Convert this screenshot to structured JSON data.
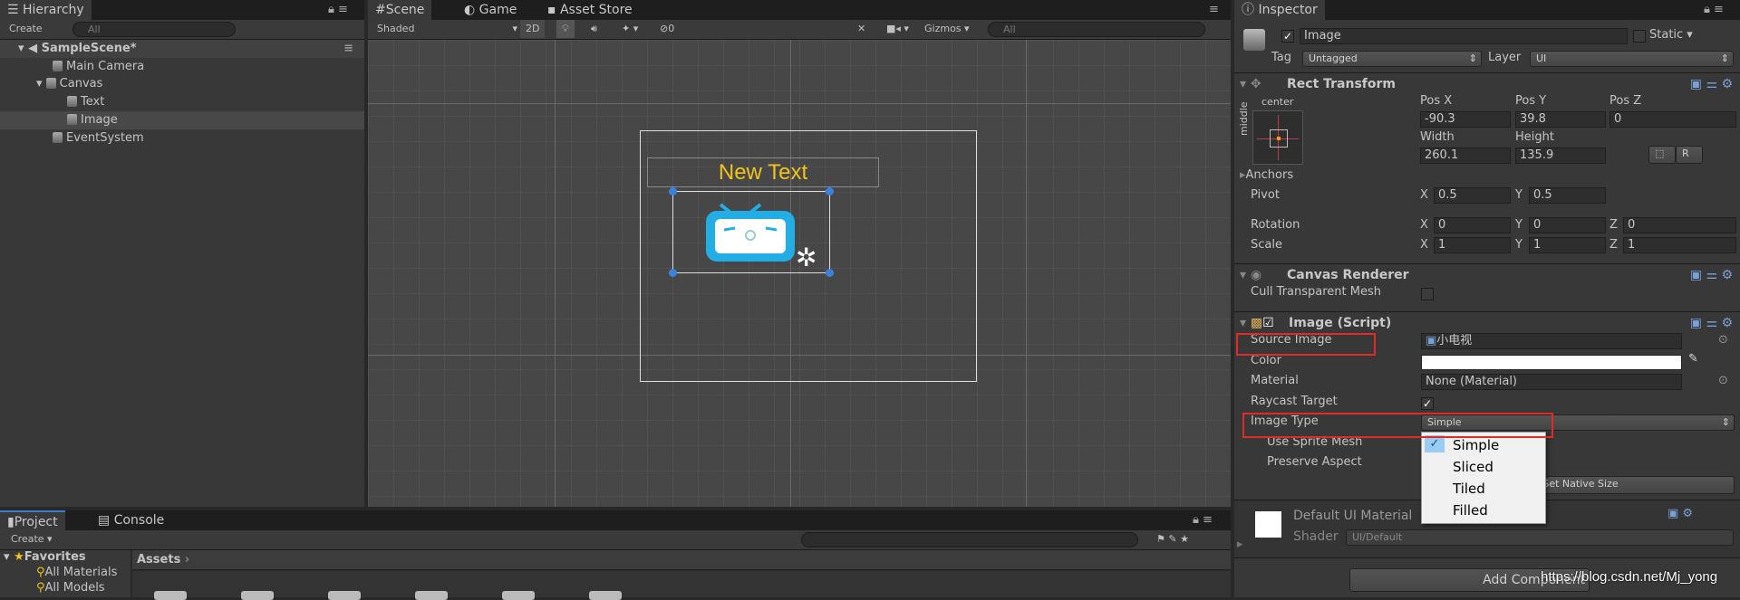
{
  "hierarchy": {
    "title": "Hierarchy",
    "create": "Create",
    "search_placeholder": "All",
    "scene": "SampleScene*",
    "items": [
      {
        "label": "Main Camera"
      },
      {
        "label": "Canvas"
      },
      {
        "label": "Text"
      },
      {
        "label": "Image"
      },
      {
        "label": "EventSystem"
      }
    ]
  },
  "scene": {
    "tabs": [
      "Scene",
      "Game",
      "Asset Store"
    ],
    "shading": "Shaded",
    "mode_2d": "2D",
    "hidden_count": "0",
    "gizmos": "Gizmos",
    "search_placeholder": "All",
    "canvas_text": "New Text"
  },
  "project": {
    "tabs": [
      "Project",
      "Console"
    ],
    "create": "Create",
    "favorites": "Favorites",
    "favorite_items": [
      "All Materials",
      "All Models"
    ],
    "breadcrumb": "Assets"
  },
  "inspector": {
    "title": "Inspector",
    "object_name": "Image",
    "static_label": "Static",
    "tag_label": "Tag",
    "tag_value": "Untagged",
    "layer_label": "Layer",
    "layer_value": "UI",
    "rect_transform": {
      "title": "Rect Transform",
      "anchor_h": "center",
      "anchor_v": "middle",
      "pos_x_label": "Pos X",
      "pos_y_label": "Pos Y",
      "pos_z_label": "Pos Z",
      "pos_x": "-90.3",
      "pos_y": "39.8",
      "pos_z": "0",
      "width_label": "Width",
      "height_label": "Height",
      "width": "260.1",
      "height": "135.9",
      "raw_button": "R",
      "anchors": "Anchors",
      "pivot": "Pivot",
      "pivot_x": "0.5",
      "pivot_y": "0.5",
      "rotation": "Rotation",
      "rot_x": "0",
      "rot_y": "0",
      "rot_z": "0",
      "scale": "Scale",
      "scale_x": "1",
      "scale_y": "1",
      "scale_z": "1",
      "x": "X",
      "y": "Y",
      "z": "Z"
    },
    "canvas_renderer": {
      "title": "Canvas Renderer",
      "cull_label": "Cull Transparent Mesh"
    },
    "image_script": {
      "title": "Image (Script)",
      "source_image_label": "Source Image",
      "source_image": "小电视",
      "color_label": "Color",
      "color": "#ffffff",
      "material_label": "Material",
      "material": "None (Material)",
      "raycast_label": "Raycast Target",
      "image_type_label": "Image Type",
      "image_type": "Simple",
      "use_sprite_mesh": "Use Sprite Mesh",
      "preserve_aspect": "Preserve Aspect",
      "native_size": "Set Native Size",
      "native_size_visible": "Native Size"
    },
    "image_type_options": [
      "Simple",
      "Sliced",
      "Tiled",
      "Filled"
    ],
    "material": {
      "name": "Default UI Material",
      "shader_label": "Shader",
      "shader": "UI/Default"
    },
    "add_component": "Add Component"
  },
  "watermark": "https://blog.csdn.net/Mj_yong"
}
